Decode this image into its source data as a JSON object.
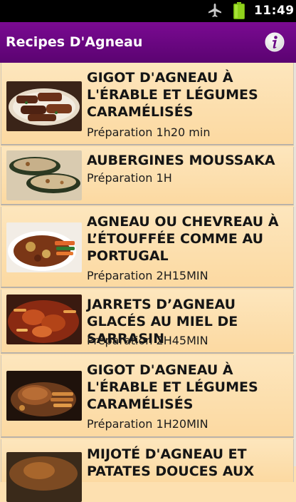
{
  "status_bar": {
    "time": "11:49",
    "icons": [
      "airplane-mode-icon",
      "battery-icon"
    ]
  },
  "app_bar": {
    "title": "Recipes D'Agneau",
    "info_icon": "info-icon",
    "accent": "#6c0684"
  },
  "recipes": [
    {
      "name": "GIGOT D'AGNEAU À L'ÉRABLE ET LÉGUMES CARAMÉLISÉS",
      "prep": "Préparation 1h20 min"
    },
    {
      "name": "AUBERGINES MOUSSAKA",
      "prep": "Préparation 1H"
    },
    {
      "name": "AGNEAU OU CHEVREAU À L’ÉTOUFFÉE COMME AU PORTUGAL",
      "prep": "Préparation 2H15MIN"
    },
    {
      "name": "JARRETS D’AGNEAU GLACÉS AU MIEL DE SARRASIN",
      "prep": "Préparation 2H45MIN"
    },
    {
      "name": "GIGOT D'AGNEAU À L'ÉRABLE ET LÉGUMES CARAMÉLISÉS",
      "prep": "Préparation 1H20MIN"
    },
    {
      "name": "MIJOTÉ D'AGNEAU ET PATATES DOUCES AUX",
      "prep": ""
    }
  ]
}
